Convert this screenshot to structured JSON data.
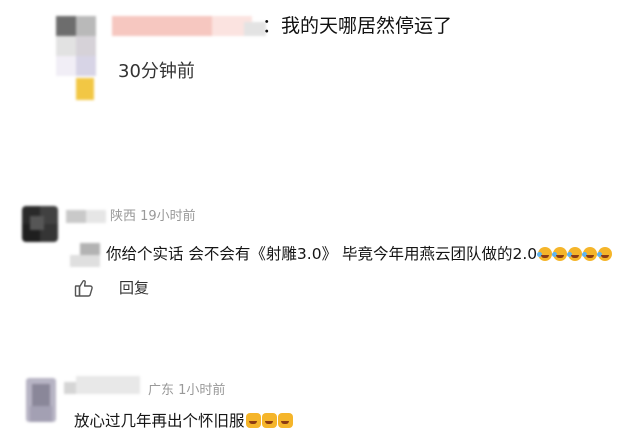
{
  "top_comment": {
    "text": "：我的天哪居然停运了",
    "time": "30分钟前"
  },
  "comments": [
    {
      "location_time": "陕西 19小时前",
      "text": "你给个实话 会不会有《射雕3.0》 毕竟今年用燕云团队做的2.0",
      "emoji_count": 5,
      "emoji_name": "laughing-tears-emoji",
      "reply_label": "回复",
      "like_icon": "thumbs-up-icon"
    },
    {
      "location_time": "广东 1小时前",
      "text": "放心过几年再出个怀旧服",
      "emoji_count": 3,
      "emoji_name": "grin-emoji"
    }
  ],
  "colors": {
    "meta_gray": "#999999",
    "text": "#151515",
    "emoji_yellow": "#f5b52a"
  }
}
